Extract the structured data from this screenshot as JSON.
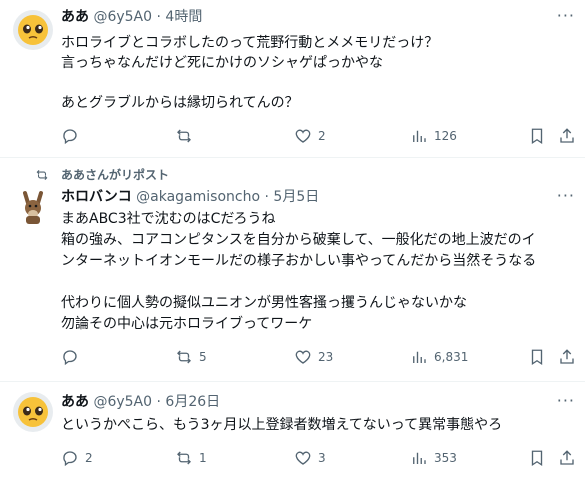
{
  "posts": [
    {
      "name": "ああ",
      "handle": "@6y5A0",
      "time": "4時間",
      "lines": [
        "ホロライブとコラボしたのって荒野行動とメメモリだっけ？",
        "言っちゃなんだけど死にかけのソシャゲぱっかやな",
        "",
        "あとグラブルからは縁切られてんの？"
      ],
      "replies": "",
      "reposts": "",
      "likes": "2",
      "views": "126"
    },
    {
      "repost_banner": "ああさんがリポスト",
      "name": "ホロバンコ",
      "handle": "@akagamisoncho",
      "time": "5月5日",
      "lines": [
        "まあABC3社で沈むのはCだろうね",
        "箱の強み、コアコンピタンスを自分から破棄して、一般化だの地上波だのイ",
        "ンターネットイオンモールだの様子おかしい事やってんだから当然そうなる",
        "",
        "代わりに個人勢の擬似ユニオンが男性客搔っ攫うんじゃないかな",
        "勿論その中心は元ホロライブってワーケ"
      ],
      "replies": "",
      "reposts": "5",
      "likes": "23",
      "views": "6,831"
    },
    {
      "name": "ああ",
      "handle": "@6y5A0",
      "time": "6月26日",
      "lines": [
        "というかぺこら、もう3ヶ月以上登録者数増えてないって異常事態やろ"
      ],
      "replies": "2",
      "reposts": "1",
      "likes": "3",
      "views": "353"
    }
  ],
  "separator": "·",
  "more_label": "···",
  "colors": {
    "text": "#0f1419",
    "secondary": "#536471",
    "divider": "#eff3f4"
  },
  "icons": [
    "reply-icon",
    "repost-icon",
    "like-icon",
    "views-icon",
    "bookmark-icon",
    "share-icon",
    "more-icon"
  ]
}
